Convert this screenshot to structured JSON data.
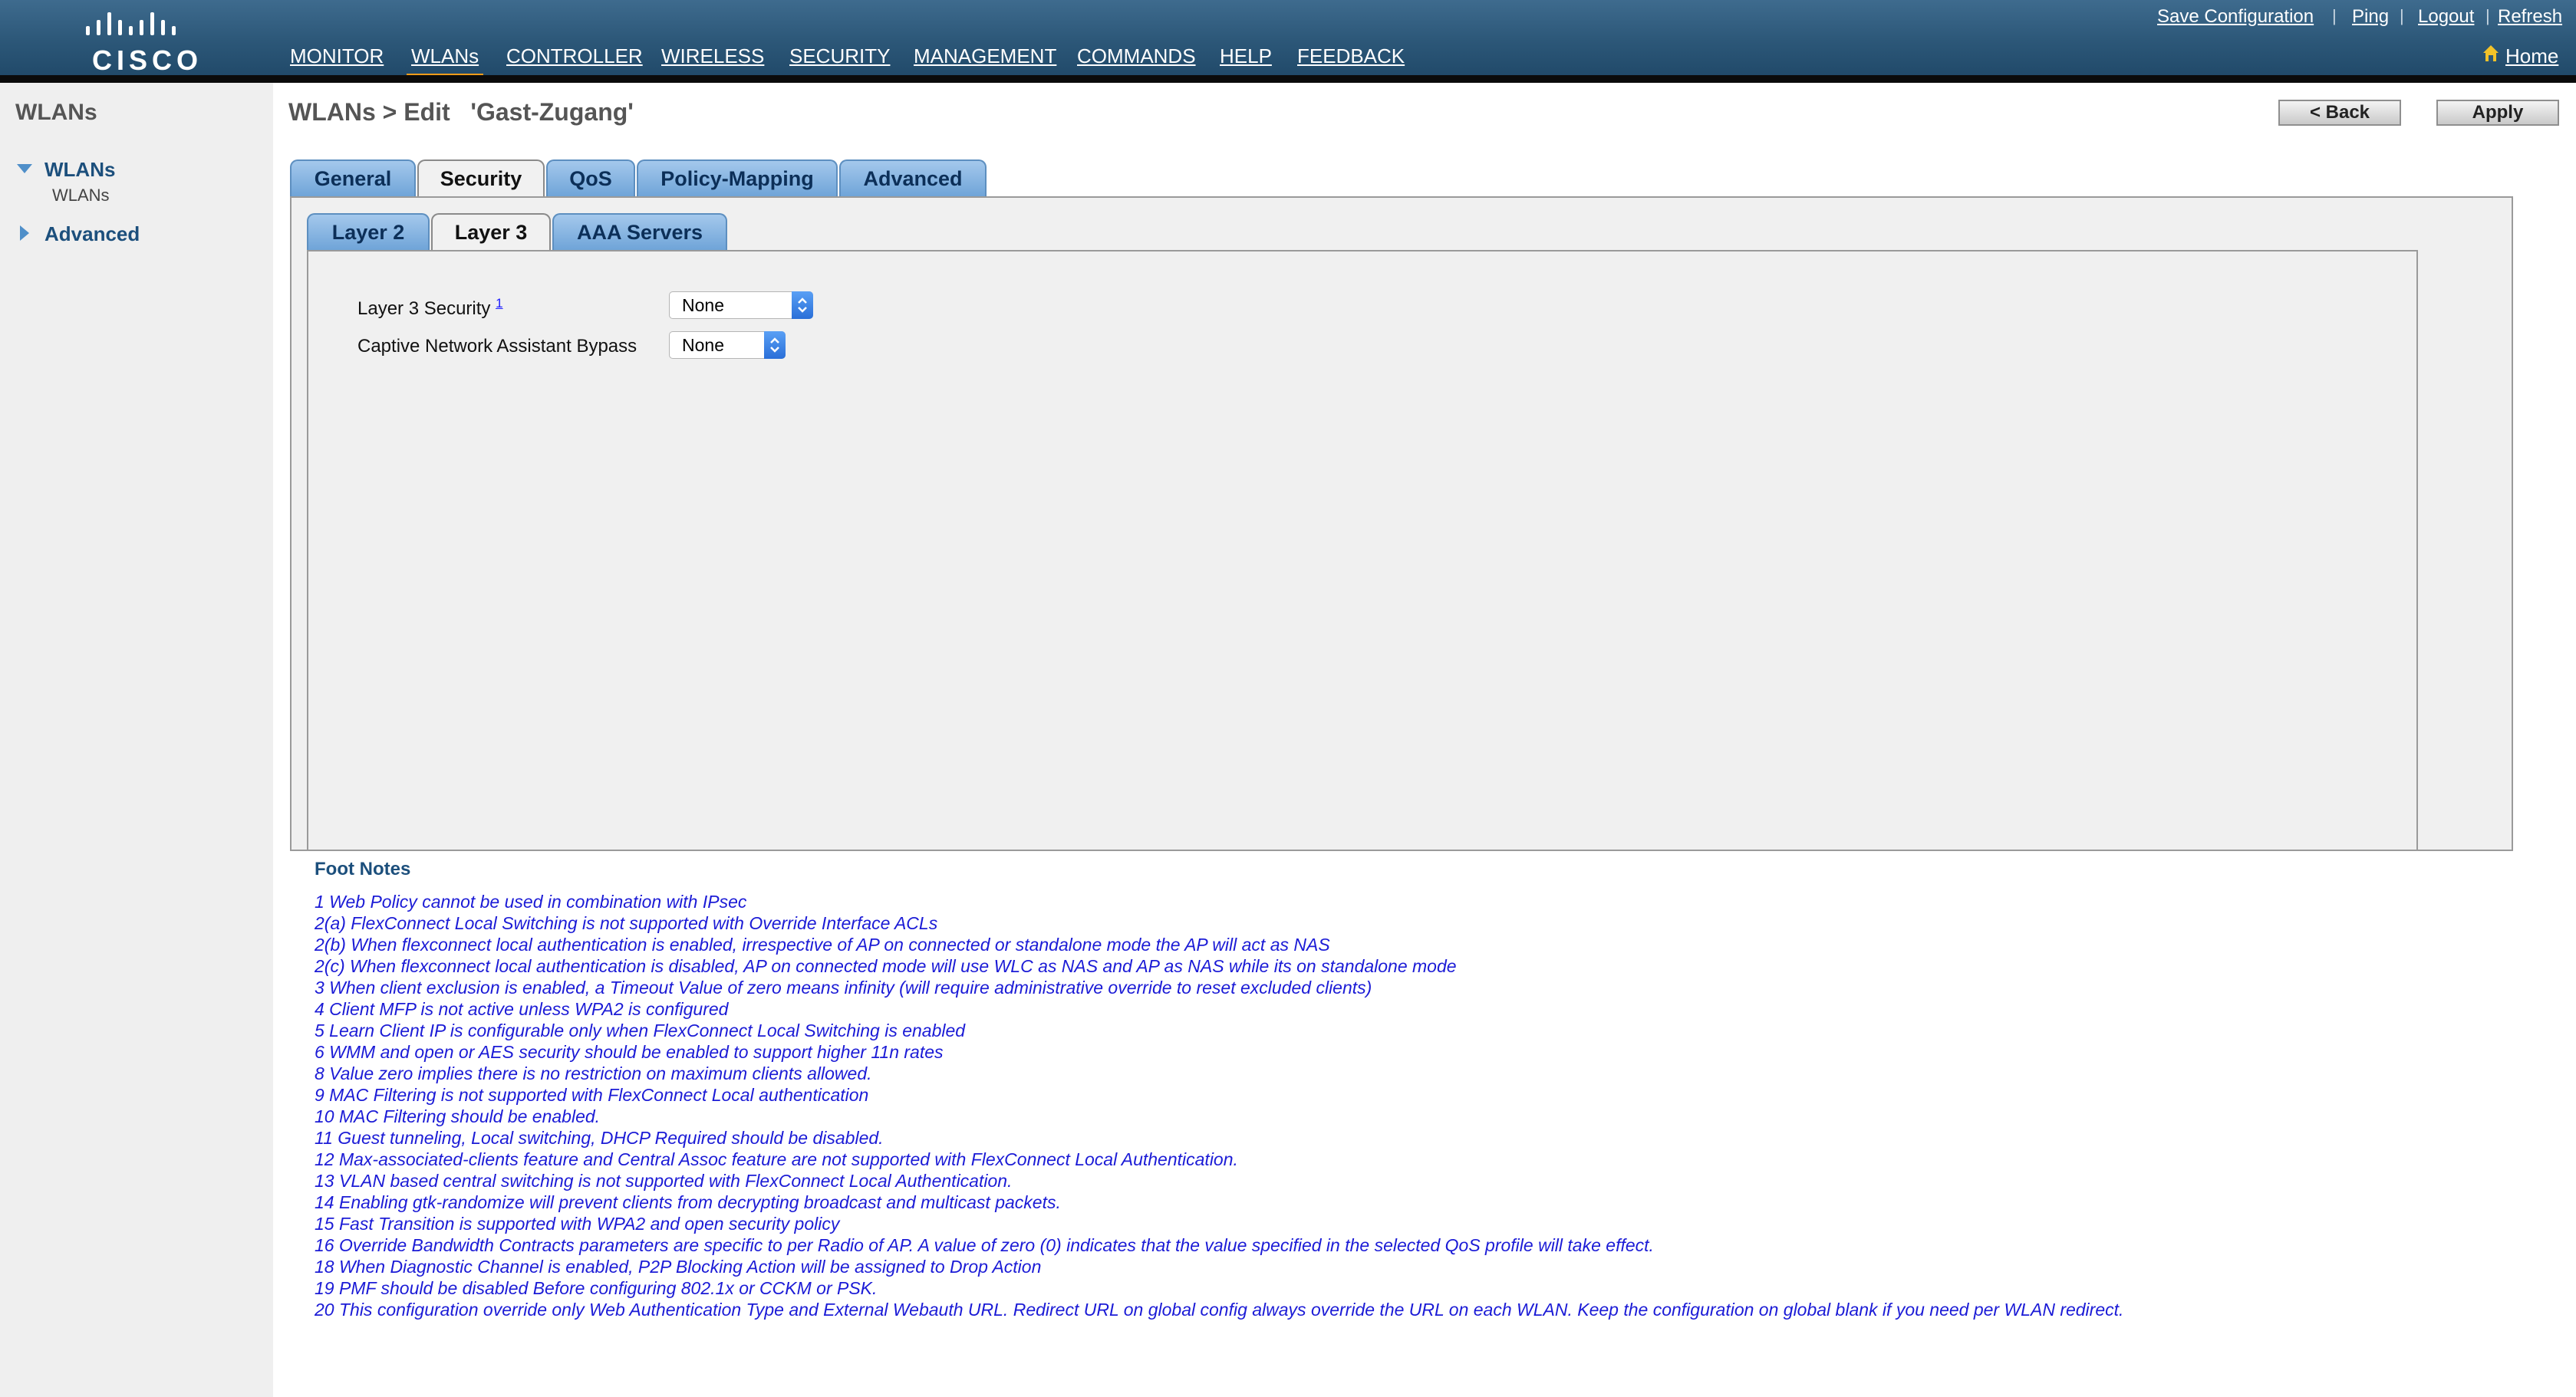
{
  "brand": {
    "logo_text": "CISCO"
  },
  "top_links": {
    "save_config": "Save Configuration",
    "ping": "Ping",
    "logout": "Logout",
    "refresh": "Refresh",
    "separator": "|"
  },
  "main_nav": [
    {
      "label": "MONITOR"
    },
    {
      "label": "WLANs",
      "active": true
    },
    {
      "label": "CONTROLLER"
    },
    {
      "label": "WIRELESS"
    },
    {
      "label": "SECURITY"
    },
    {
      "label": "MANAGEMENT"
    },
    {
      "label": "COMMANDS"
    },
    {
      "label": "HELP"
    },
    {
      "label": "FEEDBACK"
    }
  ],
  "home": {
    "label": "Home",
    "icon": "home-icon"
  },
  "sidebar": {
    "title": "WLANs",
    "sections": [
      {
        "label": "WLANs",
        "expanded": true,
        "children": [
          "WLANs"
        ]
      },
      {
        "label": "Advanced",
        "expanded": false
      }
    ]
  },
  "page": {
    "title": "WLANs > Edit   'Gast-Zugang'",
    "back_label": "< Back",
    "apply_label": "Apply"
  },
  "tabs": [
    {
      "label": "General"
    },
    {
      "label": "Security",
      "active": true
    },
    {
      "label": "QoS"
    },
    {
      "label": "Policy-Mapping"
    },
    {
      "label": "Advanced"
    }
  ],
  "subtabs": [
    {
      "label": "Layer 2"
    },
    {
      "label": "Layer 3",
      "active": true
    },
    {
      "label": "AAA Servers"
    }
  ],
  "form": {
    "layer3_security": {
      "label": "Layer 3 Security",
      "footnote_ref": "1",
      "value": "None"
    },
    "cna_bypass": {
      "label": "Captive Network Assistant Bypass",
      "value": "None"
    }
  },
  "footnotes": {
    "title": "Foot Notes",
    "items": [
      "1 Web Policy cannot be used in combination with IPsec",
      "2(a) FlexConnect Local Switching is not supported with Override Interface ACLs",
      "2(b) When flexconnect local authentication is enabled, irrespective of AP on connected or standalone mode the AP will act as NAS",
      "2(c) When flexconnect local authentication is disabled, AP on connected mode will use WLC as NAS and AP as NAS while its on standalone mode",
      "3 When client exclusion is enabled, a Timeout Value of zero means infinity (will require administrative override to reset excluded clients)",
      "4 Client MFP is not active unless WPA2 is configured",
      "5 Learn Client IP is configurable only when FlexConnect Local Switching is enabled",
      "6 WMM and open or AES security should be enabled to support higher 11n rates",
      "8 Value zero implies there is no restriction on maximum clients allowed.",
      "9 MAC Filtering is not supported with FlexConnect Local authentication",
      "10 MAC Filtering should be enabled.",
      "11 Guest tunneling, Local switching, DHCP Required should be disabled.",
      "12 Max-associated-clients feature and Central Assoc feature are not supported with FlexConnect Local Authentication.",
      "13 VLAN based central switching is not supported with FlexConnect Local Authentication.",
      "14 Enabling gtk-randomize will prevent clients from decrypting broadcast and multicast packets.",
      "15 Fast Transition is supported with WPA2 and open security policy",
      "16 Override Bandwidth Contracts parameters are specific to per Radio of AP. A value of zero (0) indicates that the value specified in the selected QoS profile will take effect.",
      "18 When Diagnostic Channel is enabled, P2P Blocking Action will be assigned to Drop Action",
      "19 PMF should be disabled Before configuring 802.1x or CCKM or PSK.",
      "20 This configuration override only Web Authentication Type and External Webauth URL. Redirect URL on global config always override the URL on each WLAN. Keep the configuration on global blank if you need per WLAN redirect."
    ]
  },
  "colors": {
    "header": "#2c5778",
    "active_nav_underline": "#f39c1a",
    "link_blue": "#1c4f7c",
    "footnote_blue": "#1b1bd6",
    "tab_blue": "#8fb9e4"
  }
}
